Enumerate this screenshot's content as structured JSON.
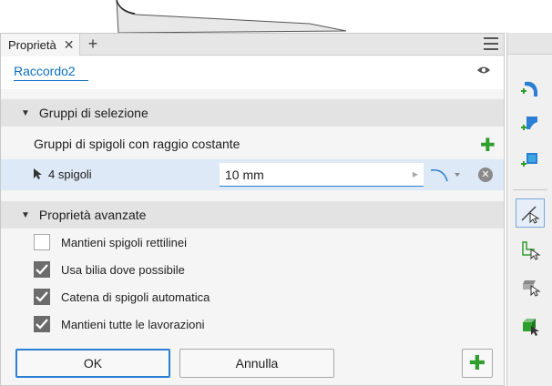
{
  "tab": {
    "label": "Proprietà",
    "close": "✕",
    "add": "+"
  },
  "feature": {
    "name": "Raccordo2"
  },
  "selection_groups": {
    "header": "Gruppi di selezione",
    "group_label": "Gruppi di spigoli con raggio costante",
    "row": {
      "edges": "4 spigoli",
      "radius": "10 mm"
    }
  },
  "advanced": {
    "header": "Proprietà avanzate",
    "options": [
      {
        "label": "Mantieni spigoli rettilinei",
        "checked": false
      },
      {
        "label": "Usa bilia dove possibile",
        "checked": true
      },
      {
        "label": "Catena di spigoli automatica",
        "checked": true
      },
      {
        "label": "Mantieni tutte le lavorazioni",
        "checked": true
      }
    ]
  },
  "buttons": {
    "ok": "OK",
    "cancel": "Annulla"
  },
  "toolstrip": {
    "tools": [
      "fillet-edge-icon",
      "fillet-face-icon",
      "fillet-full-round-icon",
      "select-edge-icon",
      "select-loop-icon",
      "select-feature-icon",
      "select-solid-icon"
    ]
  },
  "colors": {
    "accent": "#2a7fd4",
    "link": "#0a6ec8",
    "green": "#2e9e2e",
    "selected_row": "#dde9f6"
  }
}
